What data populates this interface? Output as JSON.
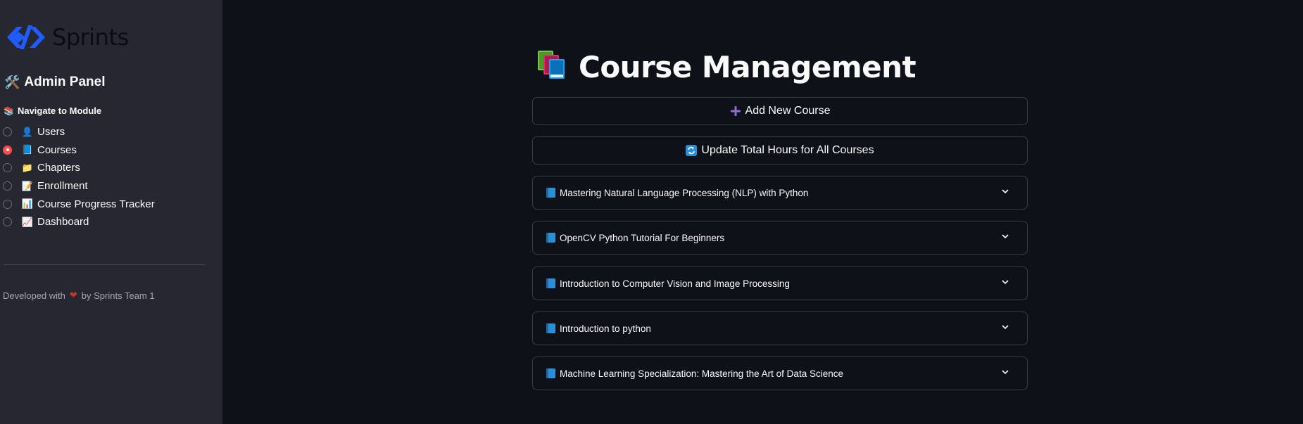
{
  "sidebar": {
    "logo_text": "Sprints",
    "admin_title": "Admin Panel",
    "admin_icon": "hammer-wrench-emoji",
    "admin_emoji": "🛠️",
    "nav_label": "Navigate to Module",
    "nav_emoji": "📚",
    "items": [
      {
        "label": "Users",
        "emoji": "👤",
        "selected": false
      },
      {
        "label": "Courses",
        "emoji": "📘",
        "selected": true
      },
      {
        "label": "Chapters",
        "emoji": "📁",
        "selected": false
      },
      {
        "label": "Enrollment",
        "emoji": "📝",
        "selected": false
      },
      {
        "label": "Course Progress Tracker",
        "emoji": "📊",
        "selected": false
      },
      {
        "label": "Dashboard",
        "emoji": "📈",
        "selected": false
      }
    ],
    "footer_prefix": "Developed with",
    "footer_heart": "❤",
    "footer_suffix": "by Sprints Team 1"
  },
  "main": {
    "title": "Course Management",
    "add_button": "Add New Course",
    "update_button": "Update Total Hours for All Courses",
    "courses": [
      "Mastering Natural Language Processing (NLP) with Python",
      "OpenCV Python Tutorial For Beginners",
      "Introduction to Computer Vision and Image Processing",
      "Introduction to python",
      "Machine Learning Specialization: Mastering the Art of Data Science"
    ]
  },
  "colors": {
    "sidebar_bg": "#262730",
    "main_bg": "#0e1117",
    "accent": "#ff4b4b",
    "logo_blue": "#1f5bff"
  }
}
